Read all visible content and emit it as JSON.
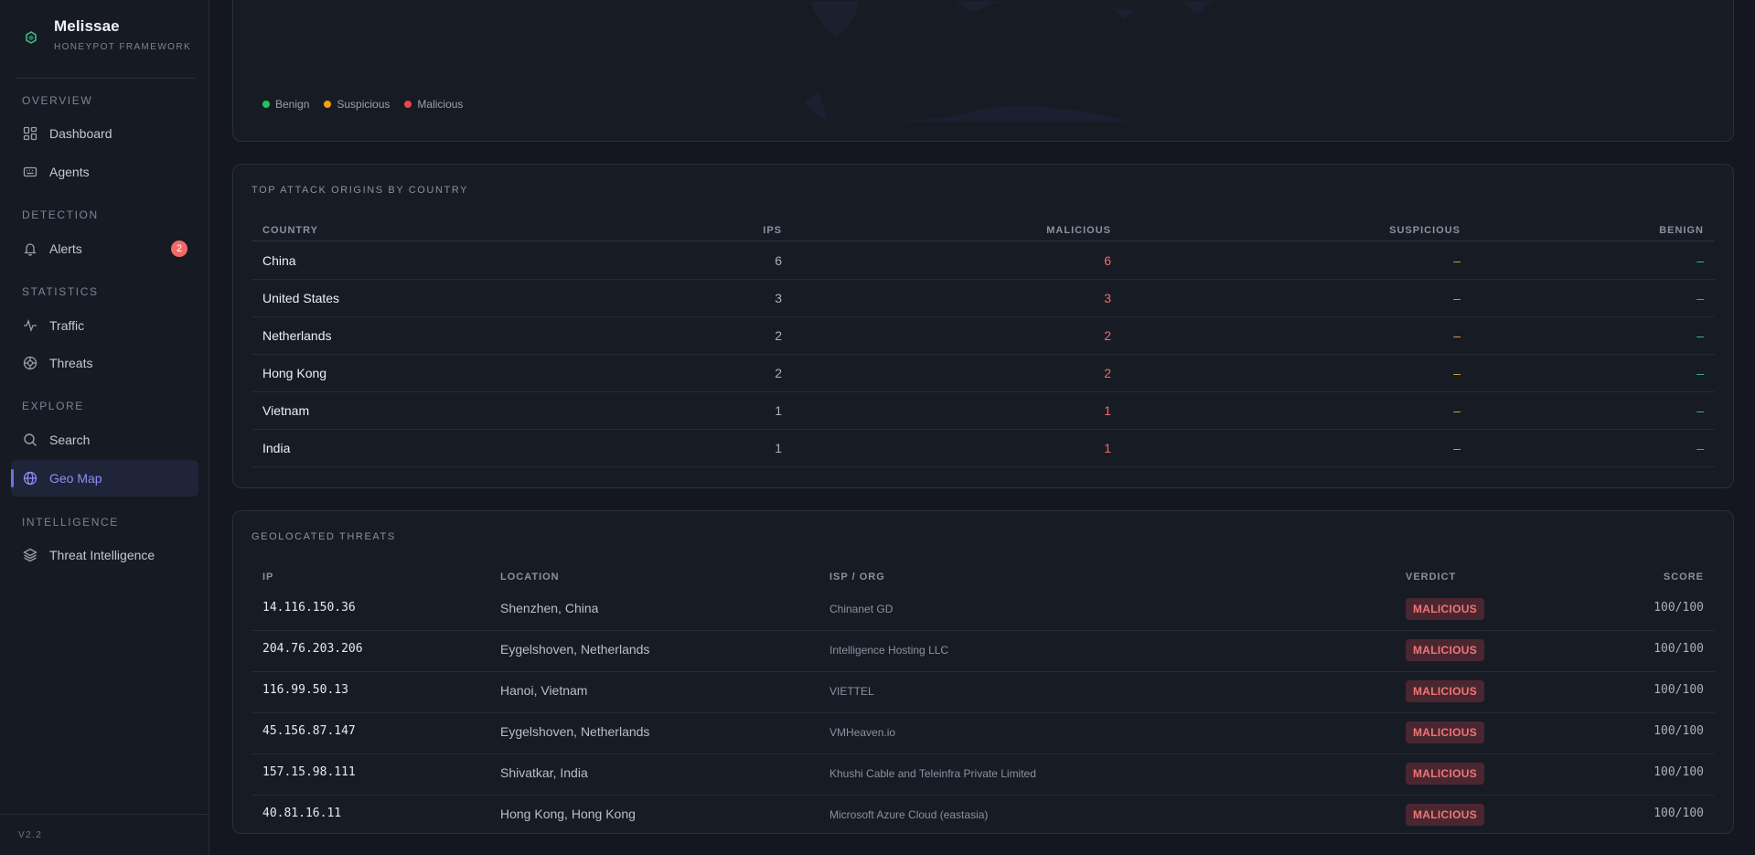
{
  "app": {
    "name": "Melissae",
    "subtitle": "HONEYPOT FRAMEWORK",
    "version": "V2.2"
  },
  "sidebar": {
    "sections": [
      {
        "label": "OVERVIEW"
      },
      {
        "label": "DETECTION"
      },
      {
        "label": "STATISTICS"
      },
      {
        "label": "EXPLORE"
      },
      {
        "label": "INTELLIGENCE"
      }
    ],
    "items": [
      {
        "label": "Dashboard",
        "icon": "dashboard-icon"
      },
      {
        "label": "Agents",
        "icon": "agents-icon"
      },
      {
        "label": "Alerts",
        "icon": "bell-icon",
        "badge": "2"
      },
      {
        "label": "Traffic",
        "icon": "pulse-icon"
      },
      {
        "label": "Threats",
        "icon": "target-icon"
      },
      {
        "label": "Search",
        "icon": "search-icon"
      },
      {
        "label": "Geo Map",
        "icon": "globe-icon",
        "active": true
      },
      {
        "label": "Threat Intelligence",
        "icon": "layers-icon"
      }
    ]
  },
  "map": {
    "legend": [
      {
        "label": "Benign",
        "color": "#22c55e"
      },
      {
        "label": "Suspicious",
        "color": "#f59e0b"
      },
      {
        "label": "Malicious",
        "color": "#ef4444"
      }
    ]
  },
  "countries": {
    "title": "TOP ATTACK ORIGINS BY COUNTRY",
    "columns": [
      "COUNTRY",
      "IPS",
      "MALICIOUS",
      "SUSPICIOUS",
      "BENIGN"
    ],
    "rows": [
      {
        "country": "China",
        "ips": "6",
        "malicious": "6",
        "suspicious": "–",
        "benign": "–"
      },
      {
        "country": "United States",
        "ips": "3",
        "malicious": "3",
        "suspicious": "–",
        "benign": "–"
      },
      {
        "country": "Netherlands",
        "ips": "2",
        "malicious": "2",
        "suspicious": "–",
        "benign": "–"
      },
      {
        "country": "Hong Kong",
        "ips": "2",
        "malicious": "2",
        "suspicious": "–",
        "benign": "–"
      },
      {
        "country": "Vietnam",
        "ips": "1",
        "malicious": "1",
        "suspicious": "–",
        "benign": "–"
      },
      {
        "country": "India",
        "ips": "1",
        "malicious": "1",
        "suspicious": "–",
        "benign": "–"
      }
    ]
  },
  "threats": {
    "title": "GEOLOCATED THREATS",
    "columns": [
      "IP",
      "LOCATION",
      "ISP / ORG",
      "VERDICT",
      "SCORE"
    ],
    "rows": [
      {
        "ip": "14.116.150.36",
        "location": "Shenzhen, China",
        "isp": "Chinanet GD",
        "verdict": "MALICIOUS",
        "score": "100/100"
      },
      {
        "ip": "204.76.203.206",
        "location": "Eygelshoven, Netherlands",
        "isp": "Intelligence Hosting LLC",
        "verdict": "MALICIOUS",
        "score": "100/100"
      },
      {
        "ip": "116.99.50.13",
        "location": "Hanoi, Vietnam",
        "isp": "VIETTEL",
        "verdict": "MALICIOUS",
        "score": "100/100"
      },
      {
        "ip": "45.156.87.147",
        "location": "Eygelshoven, Netherlands",
        "isp": "VMHeaven.io",
        "verdict": "MALICIOUS",
        "score": "100/100"
      },
      {
        "ip": "157.15.98.111",
        "location": "Shivatkar, India",
        "isp": "Khushi Cable and Teleinfra Private Limited",
        "verdict": "MALICIOUS",
        "score": "100/100"
      },
      {
        "ip": "40.81.16.11",
        "location": "Hong Kong, Hong Kong",
        "isp": "Microsoft Azure Cloud (eastasia)",
        "verdict": "MALICIOUS",
        "score": "100/100"
      }
    ]
  }
}
